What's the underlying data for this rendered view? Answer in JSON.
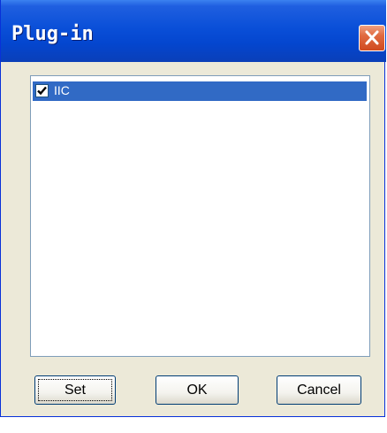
{
  "window": {
    "title": "Plug-in"
  },
  "plugin_list": {
    "items": [
      {
        "label": "IIC",
        "checked": true,
        "selected": true
      }
    ]
  },
  "buttons": {
    "set_label": "Set",
    "ok_label": "OK",
    "cancel_label": "Cancel"
  },
  "colors": {
    "titlebar": "#0a4fd8",
    "selection": "#316ac5",
    "dialog_bg": "#ece9d8",
    "close_button": "#d04a20"
  },
  "icons": {
    "close": "close-icon",
    "check": "checkmark-icon"
  }
}
